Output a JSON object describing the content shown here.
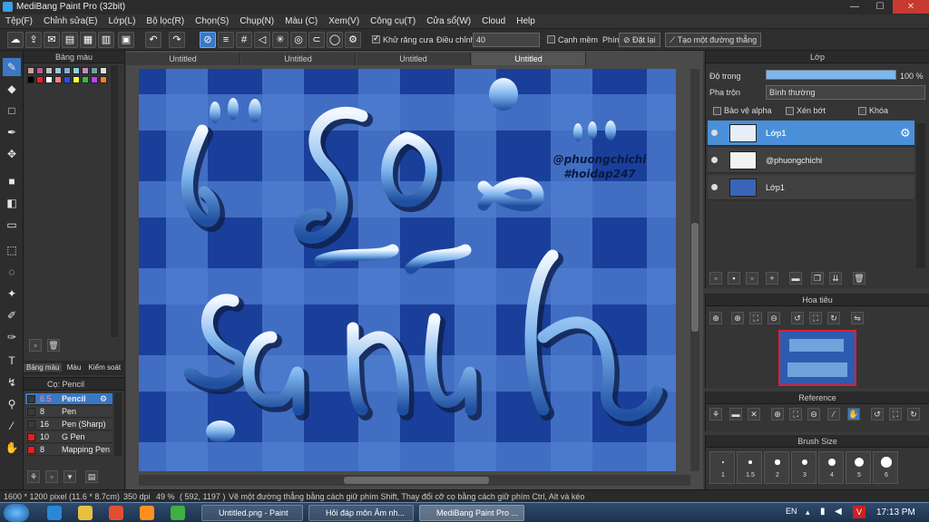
{
  "window": {
    "title": "MediBang Paint Pro (32bit)",
    "minimize": "—",
    "maximize": "☐",
    "close": "✕"
  },
  "menu": [
    "Tệp(F)",
    "Chỉnh sửa(E)",
    "Lớp(L)",
    "Bộ lọc(R)",
    "Chọn(S)",
    "Chụp(N)",
    "Màu (C)",
    "Xem(V)",
    "Công cụ(T)",
    "Cửa sổ(W)",
    "Cloud",
    "Help"
  ],
  "toolbar": {
    "antialias_label": "Khử răng cưa",
    "adjust_label": "Điều chỉnh",
    "adjust_value": "40",
    "soft_edge_label": "Cạnh mềm",
    "key_label": "Phím",
    "reset_label": "Đặt lại",
    "line_label": "Tạo một đường thẳng"
  },
  "tabs": [
    "Untitled",
    "Untitled",
    "Untitled",
    "Untitled"
  ],
  "palette": {
    "title": "Bảng màu",
    "colors": [
      "#c9a0a0",
      "#b06090",
      "#c0c0c0",
      "#a0c0e0",
      "#80b0d0",
      "#90d0e0",
      "#c090c0",
      "#70a0a0",
      "#e0e0e0",
      "#000000",
      "#ff2020",
      "#ffffff",
      "#ff8080",
      "#2050ff",
      "#ffff40",
      "#30c040",
      "#c040ff",
      "#ff8020"
    ],
    "tabs": [
      "Bảng màu",
      "Màu",
      "Kiểm soát c"
    ]
  },
  "brush": {
    "title": "Cọ: Pencil",
    "items": [
      {
        "size": "6.5",
        "name": "Pencil",
        "color": "#3a3a3a"
      },
      {
        "size": "8",
        "name": "Pen",
        "color": "#3a3a3a"
      },
      {
        "size": "16",
        "name": "Pen (Sharp)",
        "color": "#3a3a3a"
      },
      {
        "size": "10",
        "name": "G Pen",
        "color": "#e02020"
      },
      {
        "size": "8",
        "name": "Mapping Pen",
        "color": "#e02020"
      }
    ]
  },
  "layers": {
    "title": "Lớp",
    "opacity_label": "Độ trong",
    "opacity_value": "100 %",
    "opacity_fraction": 1.0,
    "blend_label": "Pha trộn",
    "blend_value": "Bình thường",
    "protect_alpha": "Bảo vệ alpha",
    "clipping": "Xén bớt",
    "lock": "Khóa",
    "items": [
      "Lớp1",
      "@phuongchichi",
      "Lớp1"
    ]
  },
  "navigator": {
    "title": "Hoa tiêu"
  },
  "reference": {
    "title": "Reference"
  },
  "brush_size": {
    "title": "Brush Size",
    "values": [
      "1",
      "1.5",
      "2",
      "3",
      "4",
      "5",
      "6"
    ]
  },
  "artwork": {
    "watermark1": "@phuongchichi",
    "watermark2": "#hoidap247"
  },
  "status": {
    "size": "1600 * 1200 pixel",
    "cm": "(11.6 * 8.7cm)",
    "dpi": "350 dpi",
    "zoom": "49 %",
    "coords": "( 592, 1197 )",
    "hint": "Vẽ một đường thẳng bằng cách giữ phím Shift, Thay đổi cỡ cọ bằng cách giữ phím Ctrl, Alt và kéo"
  },
  "taskbar": {
    "tasks": [
      "Untitled.png - Paint",
      "Hỏi đáp môn Âm nh...",
      "MediBang Paint Pro ..."
    ],
    "lang": "EN",
    "time": "17:13 PM"
  }
}
